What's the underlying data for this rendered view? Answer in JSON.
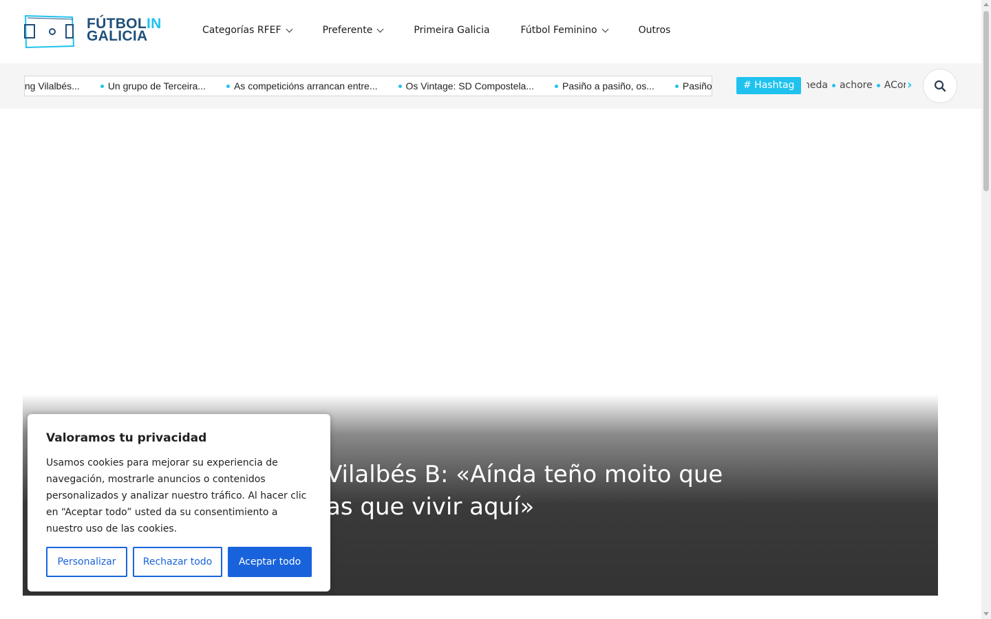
{
  "brand": {
    "line1": "FÚTBOL",
    "line1_accent": "IN",
    "line2": "GALICIA"
  },
  "nav": {
    "items": [
      {
        "label": "Categorías RFEF",
        "has_dropdown": true
      },
      {
        "label": "Preferente",
        "has_dropdown": true
      },
      {
        "label": "Primeira Galicia",
        "has_dropdown": false
      },
      {
        "label": "Fútbol Feminino",
        "has_dropdown": true
      },
      {
        "label": "Outros",
        "has_dropdown": false
      }
    ]
  },
  "ticker": {
    "items": [
      "acing Vilalbés...",
      "Un grupo de Terceira...",
      "As competicións arrancan entre...",
      "Os Vintage: SD Compostela...",
      "Pasiño a pasiño, os...",
      "Pasiño a"
    ]
  },
  "hashtags": {
    "badge": "# Hashtag",
    "items": [
      "heda",
      "achore",
      "ACor"
    ],
    "next_icon": "chevron-right-icon"
  },
  "search": {
    "icon": "search-icon"
  },
  "hero": {
    "title": "Vilalbés B: «Aínda teño moito que\nas que vivir aquí»"
  },
  "cookie": {
    "title": "Valoramos tu privacidad",
    "text": "Usamos cookies para mejorar su experiencia de navegación, mostrarle anuncios o contenidos personalizados y analizar nuestro tráfico. Al hacer clic en “Aceptar todo” usted da su consentimiento a nuestro uso de las cookies.",
    "customize": "Personalizar",
    "reject": "Rechazar todo",
    "accept": "Aceptar todo"
  },
  "colors": {
    "accent": "#1fc2ef",
    "brand_dark": "#1f4f7a",
    "button_blue": "#1863dc"
  }
}
